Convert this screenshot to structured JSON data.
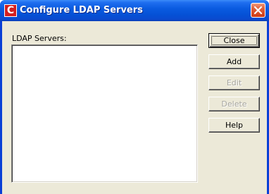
{
  "window": {
    "title": "Configure LDAP Servers",
    "app_icon": "C",
    "close_icon": "close-icon"
  },
  "list": {
    "label": "LDAP Servers:",
    "items": []
  },
  "buttons": {
    "close": {
      "label": "Close",
      "enabled": true,
      "default": true
    },
    "add": {
      "label": "Add",
      "enabled": true
    },
    "edit": {
      "label": "Edit",
      "enabled": false
    },
    "delete": {
      "label": "Delete",
      "enabled": false
    },
    "help": {
      "label": "Help",
      "enabled": true
    }
  },
  "colors": {
    "titlebar": "#0a5be0",
    "dialog_face": "#ece9d8",
    "close_button": "#cf3b14",
    "app_icon": "#d31f1f",
    "disabled_text": "#a7a69f"
  }
}
